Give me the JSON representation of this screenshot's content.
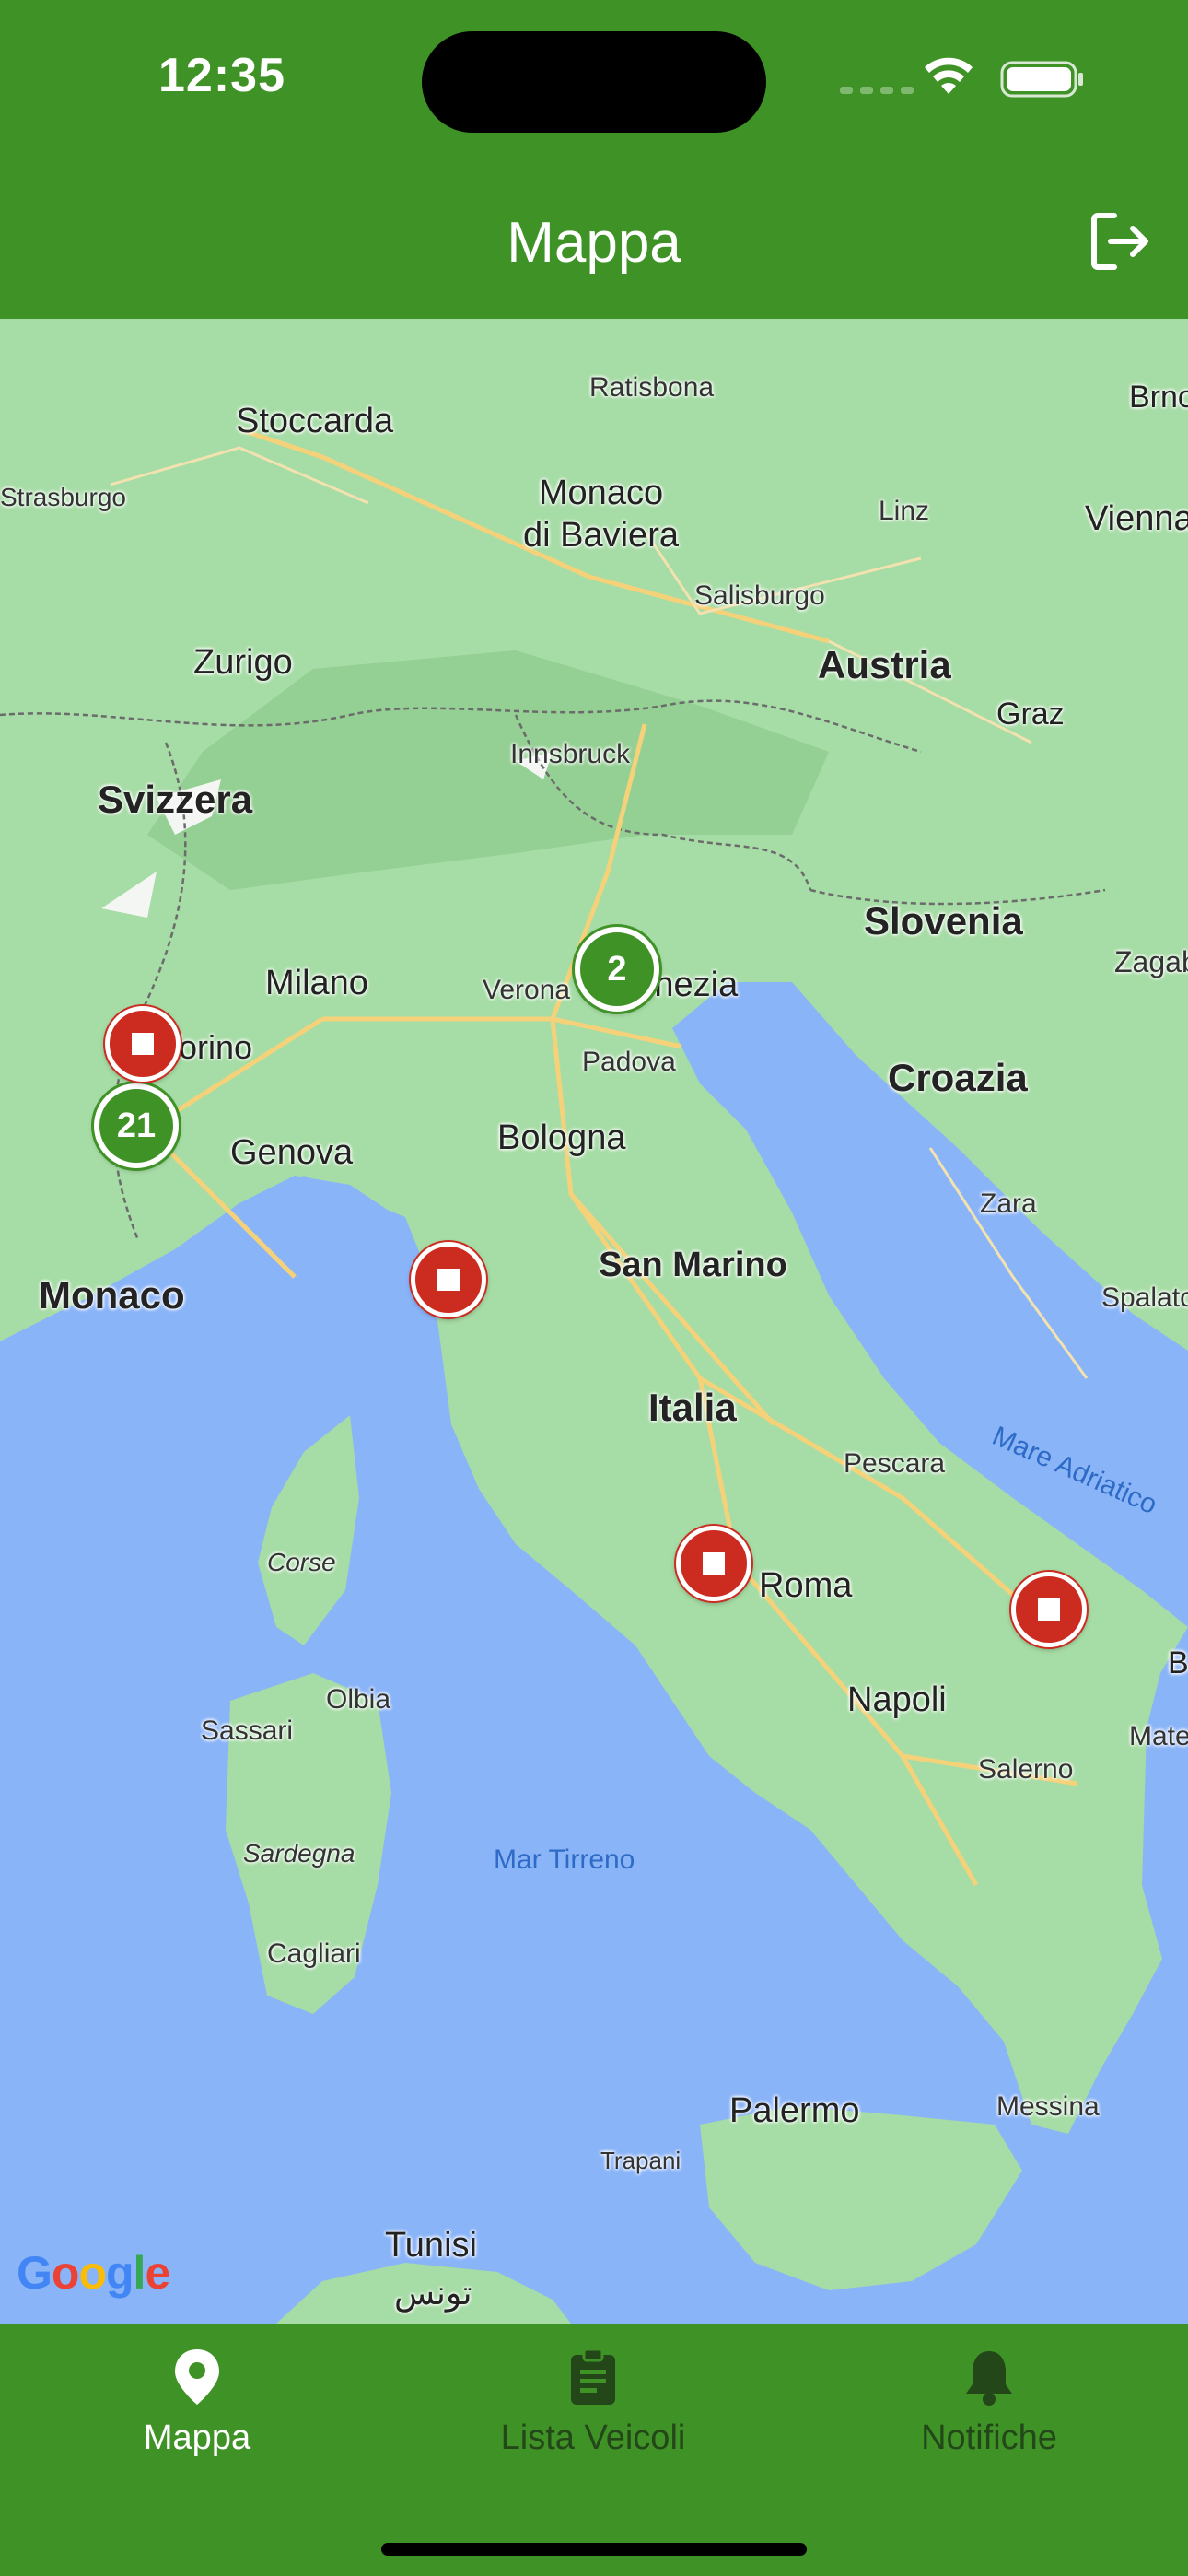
{
  "status_bar": {
    "time": "12:35"
  },
  "header": {
    "title": "Mappa",
    "logout_icon": "logout-icon"
  },
  "map": {
    "country_labels": [
      "Svizzera",
      "Austria",
      "Slovenia",
      "Croazia",
      "Italia",
      "Monaco",
      "San Marino"
    ],
    "city_labels": [
      "Stoccarda",
      "Ratisbona",
      "Monaco\ndi Baviera",
      "Linz",
      "Vienna",
      "Strasburgo",
      "Salisburgo",
      "Zurigo",
      "Graz",
      "Innsbruck",
      "Milano",
      "Verona",
      "Venezia",
      "Padova",
      "Zagabria",
      "Genova",
      "Bologna",
      "Zara",
      "Spalato",
      "Pescara",
      "Roma",
      "Napoli",
      "Salerno",
      "Sassari",
      "Olbia",
      "Cagliari",
      "Palermo",
      "Messina",
      "Tunisi",
      "تونس",
      "Brno",
      "Matera",
      "Bari",
      "Trapani",
      "Torino"
    ],
    "island_labels": [
      "Corse",
      "Sardegna"
    ],
    "sea_labels": [
      "Mar Tirreno",
      "Mare Adriatico"
    ],
    "clusters": [
      {
        "count": "2",
        "near": "Venezia"
      },
      {
        "count": "21",
        "near": "Torino"
      }
    ],
    "markers": [
      "Torino",
      "La Spezia",
      "Roma",
      "Foggia"
    ],
    "attribution": "Google",
    "controls": [
      {
        "name": "satellite-toggle",
        "icon": "satellite-icon"
      },
      {
        "name": "zoom-in",
        "label": "+"
      },
      {
        "name": "zoom-out",
        "label": "−"
      }
    ]
  },
  "nav": {
    "items": [
      {
        "label": "Mappa",
        "icon": "map-pin-icon",
        "active": true
      },
      {
        "label": "Lista Veicoli",
        "icon": "clipboard-icon",
        "active": false
      },
      {
        "label": "Notifiche",
        "icon": "bell-icon",
        "active": false
      }
    ]
  },
  "colors": {
    "brand_green": "#3f9226",
    "marker_red": "#cc2b20",
    "sea": "#8ab4f8",
    "land": "#a6dca5"
  }
}
